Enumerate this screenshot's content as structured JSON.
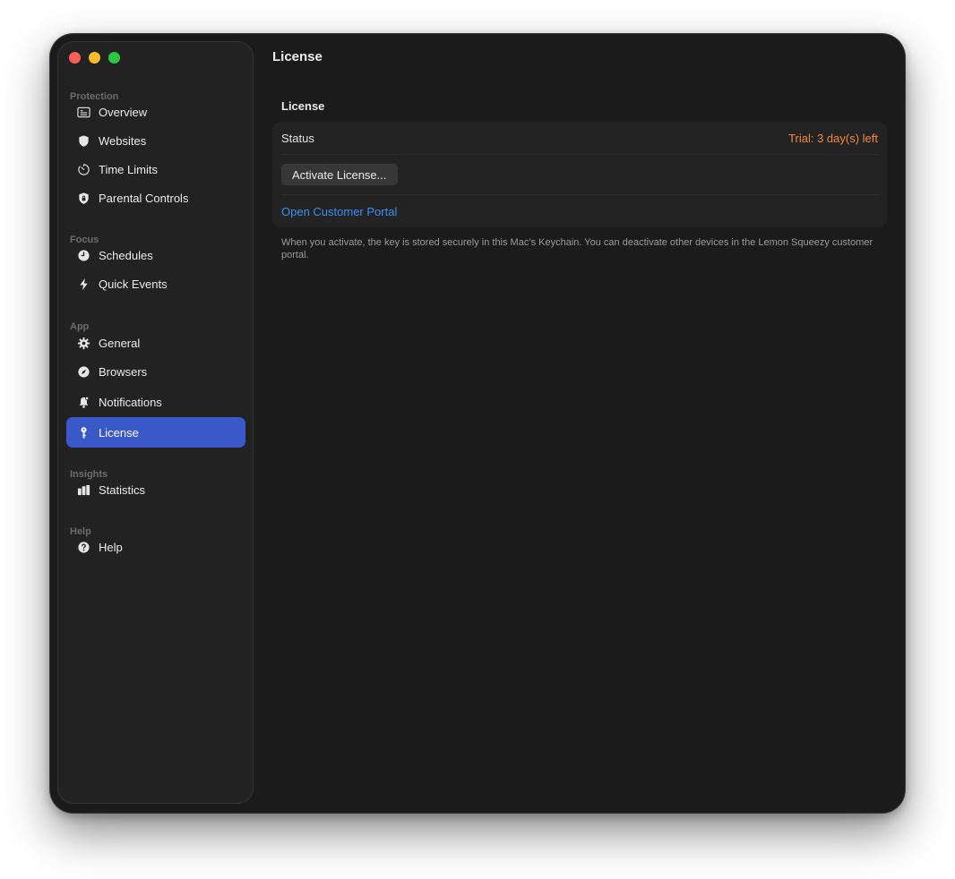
{
  "window": {
    "title": "License"
  },
  "sidebar": {
    "sections": [
      {
        "label": "Protection",
        "items": [
          {
            "label": "Overview",
            "icon": "overview-icon"
          },
          {
            "label": "Websites",
            "icon": "shield-icon"
          },
          {
            "label": "Time Limits",
            "icon": "timer-icon"
          },
          {
            "label": "Parental Controls",
            "icon": "shield-lock-icon"
          }
        ]
      },
      {
        "label": "Focus",
        "items": [
          {
            "label": "Schedules",
            "icon": "clock-icon"
          },
          {
            "label": "Quick Events",
            "icon": "bolt-icon"
          }
        ]
      },
      {
        "label": "App",
        "items": [
          {
            "label": "General",
            "icon": "gear-icon"
          },
          {
            "label": "Browsers",
            "icon": "compass-icon"
          },
          {
            "label": "Notifications",
            "icon": "bell-icon"
          },
          {
            "label": "License",
            "icon": "key-icon",
            "active": true
          }
        ]
      },
      {
        "label": "Insights",
        "items": [
          {
            "label": "Statistics",
            "icon": "chart-icon"
          }
        ]
      },
      {
        "label": "Help",
        "items": [
          {
            "label": "Help",
            "icon": "question-icon"
          }
        ]
      }
    ]
  },
  "main": {
    "title": "License",
    "group_title": "License",
    "status_label": "Status",
    "status_value": "Trial: 3 day(s) left",
    "activate_button": "Activate License...",
    "portal_link": "Open Customer Portal",
    "footnote": "When you activate, the key is stored securely in this Mac’s Keychain. You can deactivate other devices in the Lemon Squeezy customer portal."
  },
  "colors": {
    "accent": "#3a59c9",
    "status_trial": "#f0883a",
    "link": "#3a8ff0",
    "window_bg": "#1b1b1b",
    "sidebar_bg": "#222222"
  }
}
